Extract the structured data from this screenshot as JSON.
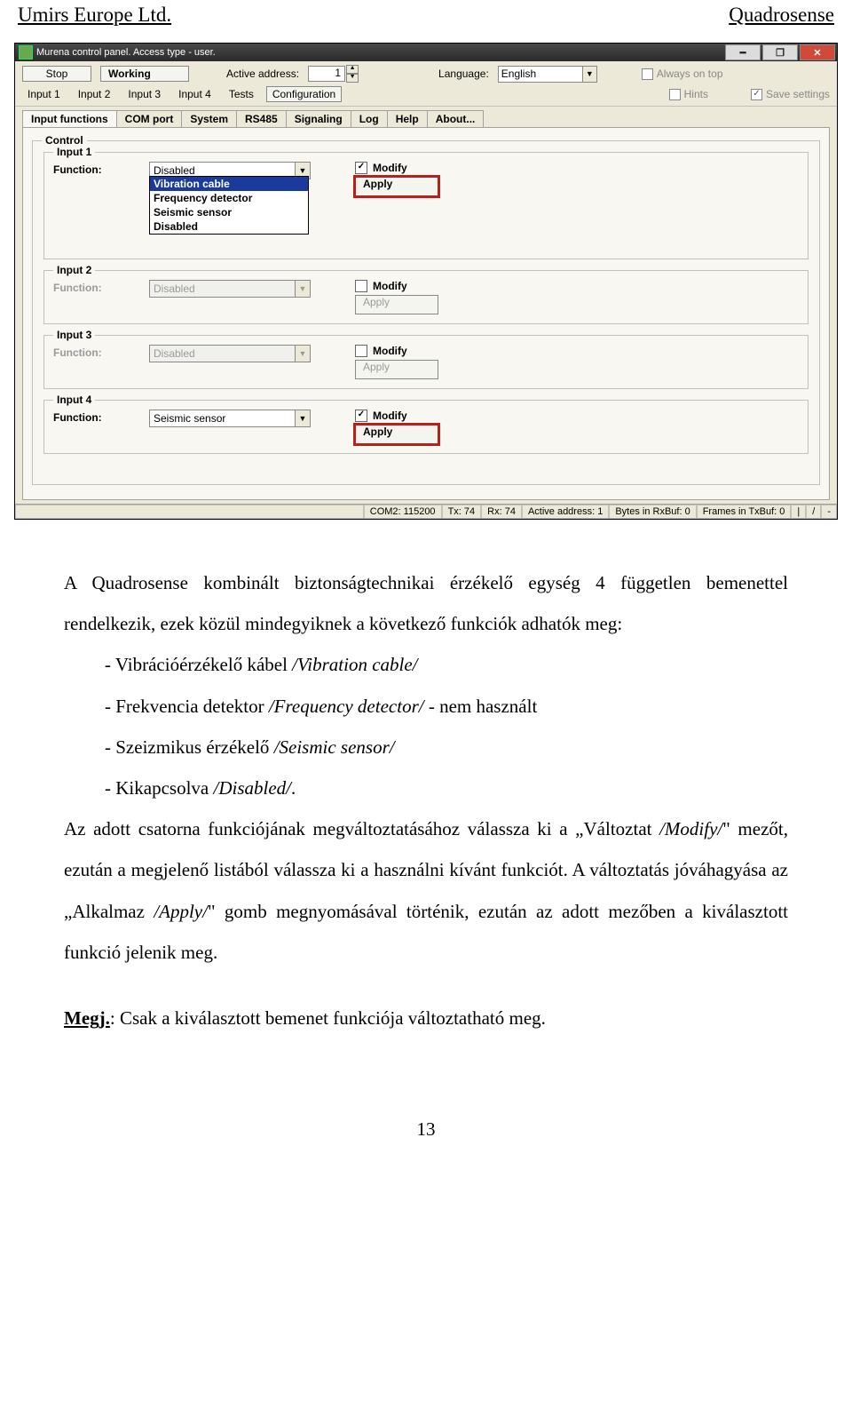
{
  "header": {
    "left": "Umirs Europe Ltd.",
    "right": "Quadrosense"
  },
  "window": {
    "title": "Murena control panel. Access type - user.",
    "stop": "Stop",
    "working": "Working",
    "active_addr_label": "Active address:",
    "active_addr_value": "1",
    "language_label": "Language:",
    "language_value": "English",
    "always_on_top": "Always on top",
    "hints": "Hints",
    "save_settings": "Save settings",
    "menus": [
      "Input 1",
      "Input 2",
      "Input 3",
      "Input 4",
      "Tests",
      "Configuration"
    ],
    "subtabs": [
      "Input functions",
      "COM port",
      "System",
      "RS485",
      "Signaling",
      "Log",
      "Help",
      "About..."
    ]
  },
  "inputs": {
    "control_legend": "Control",
    "function_label": "Function:",
    "modify_label": "Modify",
    "apply_label": "Apply",
    "list": [
      {
        "legend": "Input 1",
        "value": "Disabled",
        "modify": true,
        "enabled": true,
        "highlight": true,
        "open": true
      },
      {
        "legend": "Input 2",
        "value": "Disabled",
        "modify": false,
        "enabled": false,
        "highlight": false,
        "open": false
      },
      {
        "legend": "Input 3",
        "value": "Disabled",
        "modify": false,
        "enabled": false,
        "highlight": false,
        "open": false
      },
      {
        "legend": "Input 4",
        "value": "Seismic sensor",
        "modify": true,
        "enabled": true,
        "highlight": true,
        "open": false
      }
    ],
    "options": [
      "Vibration cable",
      "Frequency detector",
      "Seismic sensor",
      "Disabled"
    ],
    "selected_option_index": 0
  },
  "statusbar": {
    "com": "COM2: 115200",
    "tx": "Tx: 74",
    "rx": "Rx: 74",
    "addr": "Active address:  1",
    "rxbuf": "Bytes in RxBuf: 0",
    "txbuf": "Frames in TxBuf: 0",
    "tail1": "|",
    "tail2": "/",
    "tail3": "-"
  },
  "body": {
    "p1": "A Quadrosense kombinált biztonságtechnikai érzékelő egység 4 független bemenettel rendelkezik, ezek közül mindegyiknek a következő funkciók adhatók meg:",
    "li1a": "Vibrációérzékelő kábel ",
    "li1b": "/Vibration cable/",
    "li2a": "Frekvencia detektor ",
    "li2b": "/Frequency detector/",
    "li2c": " - nem használt",
    "li3a": "Szeizmikus érzékelő ",
    "li3b": "/Seismic sensor/",
    "li4a": "Kikapcsolva ",
    "li4b": "/Disabled/",
    "li4c": ".",
    "p2a": "Az adott csatorna funkciójának megváltoztatásához válassza ki a „Változtat ",
    "p2b": "/Modify/",
    "p2c": "\" mezőt, ezután a megjelenő listából válassza ki a használni kívánt funkciót. A változtatás jóváhagyása az „Alkalmaz ",
    "p2d": "/Apply/",
    "p2e": "\" gomb megnyomásával történik, ezután az adott mezőben a kiválasztott funkció jelenik meg.",
    "note_label": "Megj.",
    "note_text": ": Csak a kiválasztott bemenet funkciója változtatható meg."
  },
  "page_number": "13"
}
